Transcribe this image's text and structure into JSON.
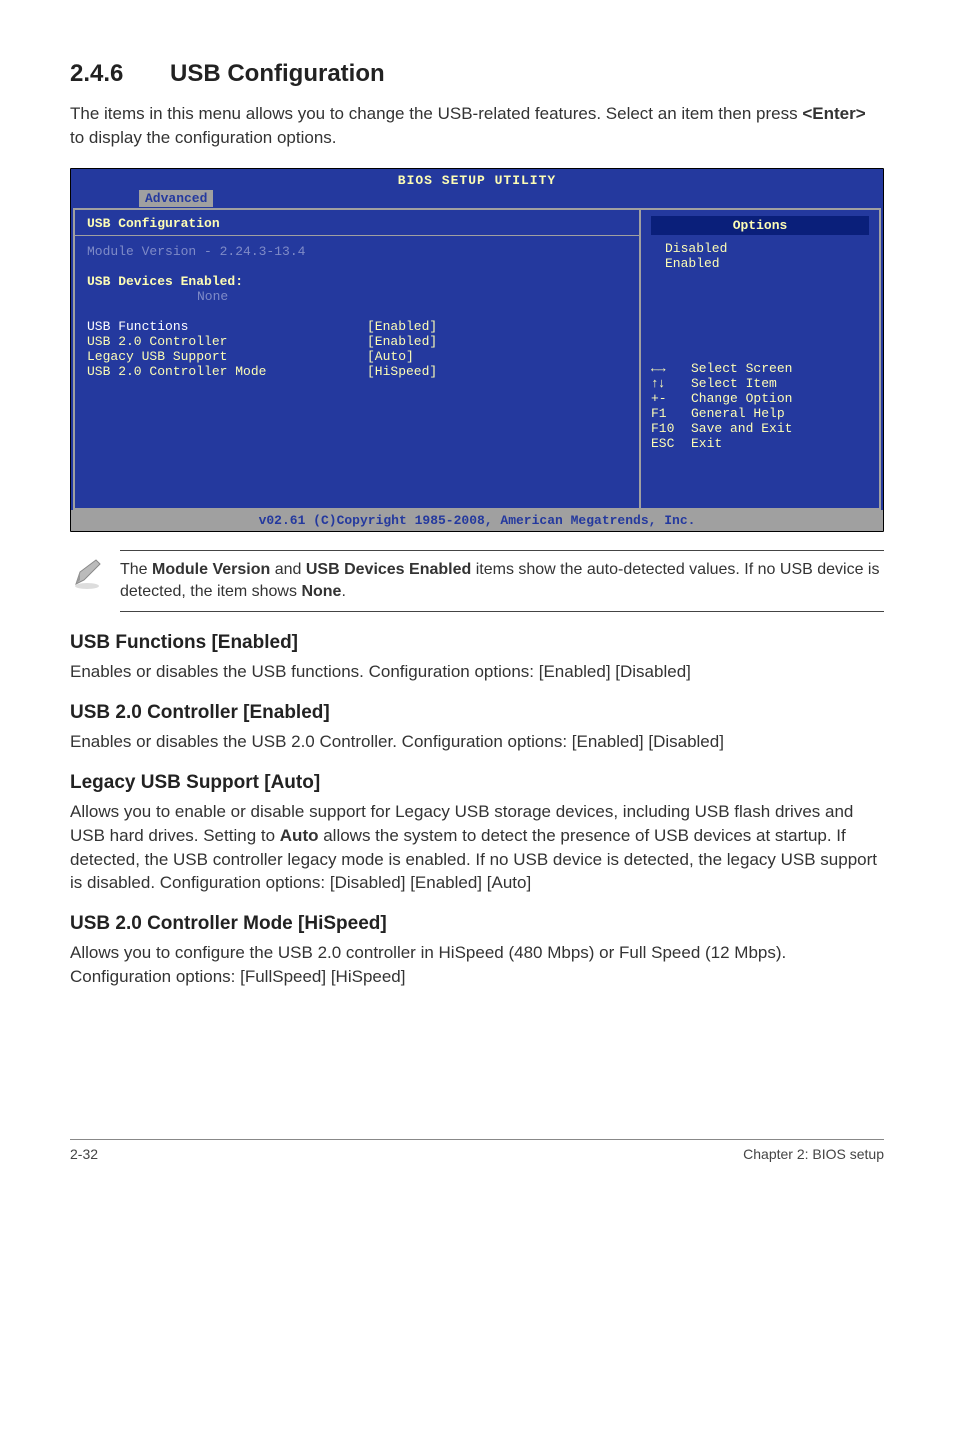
{
  "section": {
    "number": "2.4.6",
    "title": "USB Configuration",
    "intro": "The items in this menu allows you to change the USB-related features. Select an item then press ",
    "intro_key": "<Enter>",
    "intro_tail": " to display the configuration options."
  },
  "bios": {
    "title": "BIOS SETUP UTILITY",
    "tab": "Advanced",
    "header": "USB Configuration",
    "module_line": "Module Version - 2.24.3-13.4",
    "devices_label": "USB Devices Enabled:",
    "devices_value": "None",
    "rows": [
      {
        "label": "USB Functions",
        "value": "[Enabled]",
        "hl": true
      },
      {
        "label": "USB 2.0 Controller",
        "value": "[Enabled]",
        "hl": false
      },
      {
        "label": "Legacy USB Support",
        "value": "[Auto]",
        "hl": false
      },
      {
        "label": "USB 2.0 Controller Mode",
        "value": "[HiSpeed]",
        "hl": false
      }
    ],
    "options_title": "Options",
    "options": [
      "Disabled",
      "Enabled"
    ],
    "help": [
      {
        "key": "←→",
        "text": "Select Screen"
      },
      {
        "key": "↑↓",
        "text": "Select Item"
      },
      {
        "key": "+-",
        "text": "Change Option"
      },
      {
        "key": "F1",
        "text": "General Help"
      },
      {
        "key": "F10",
        "text": "Save and Exit"
      },
      {
        "key": "ESC",
        "text": "Exit"
      }
    ],
    "footer": "v02.61 (C)Copyright 1985-2008, American Megatrends, Inc."
  },
  "note": {
    "text_pre": "The ",
    "bold1": "Module Version",
    "mid1": " and ",
    "bold2": "USB Devices Enabled",
    "mid2": " items show the auto-detected values. If no USB device is detected, the item shows ",
    "bold3": "None",
    "tail": "."
  },
  "subs": {
    "s1_title": "USB Functions [Enabled]",
    "s1_body": "Enables or disables the USB functions. Configuration options: [Enabled] [Disabled]",
    "s2_title": "USB 2.0 Controller [Enabled]",
    "s2_body": "Enables or disables the USB 2.0 Controller. Configuration options:  [Enabled] [Disabled]",
    "s3_title": "Legacy USB Support [Auto]",
    "s3_body": "Allows you to enable or disable support for Legacy USB storage devices, including USB flash drives and USB hard drives. Setting to ",
    "s3_bold": "Auto",
    "s3_body2": " allows the system to detect the presence of USB devices at startup. If detected, the USB controller legacy mode is enabled. If no USB device is detected, the legacy USB support is disabled. Configuration options: [Disabled] [Enabled] [Auto]",
    "s4_title": "USB 2.0 Controller Mode [HiSpeed]",
    "s4_body": "Allows you to configure the USB 2.0 controller in HiSpeed (480 Mbps) or Full Speed (12 Mbps). Configuration options: [FullSpeed] [HiSpeed]"
  },
  "footer": {
    "left": "2-32",
    "right": "Chapter 2: BIOS setup"
  }
}
